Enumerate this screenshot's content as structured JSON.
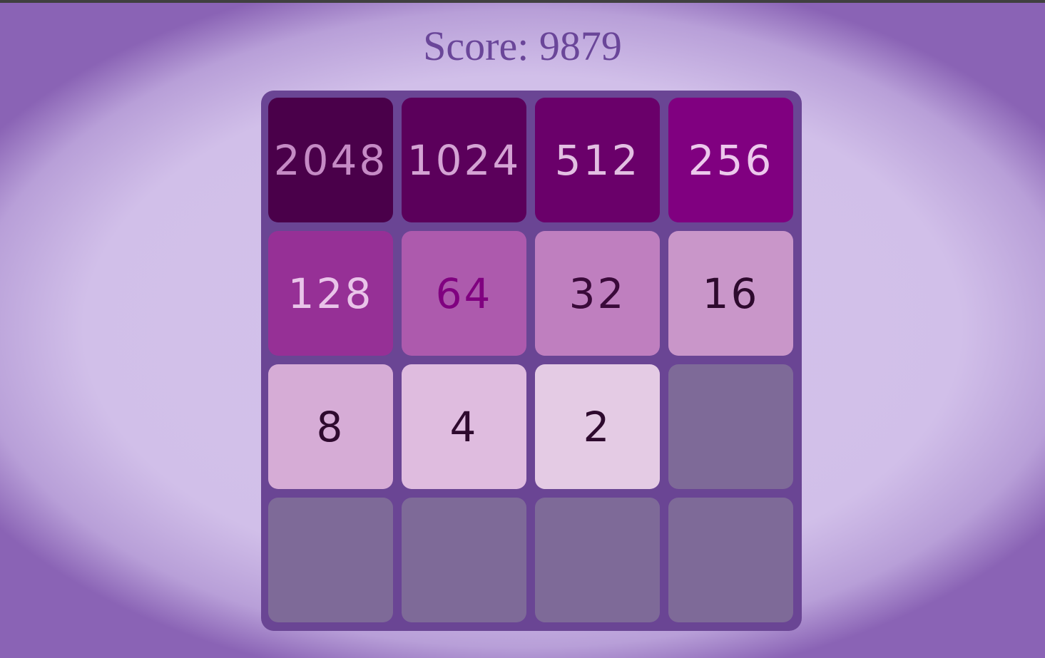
{
  "score": {
    "label": "Score: 9879"
  },
  "board": {
    "rows": [
      [
        {
          "value": "2048",
          "bg": "#4a004a",
          "fg": "#c58ac5"
        },
        {
          "value": "1024",
          "bg": "#5b005b",
          "fg": "#d4a3d4"
        },
        {
          "value": "512",
          "bg": "#6a006a",
          "fg": "#e2bfe2"
        },
        {
          "value": "256",
          "bg": "#800080",
          "fg": "#ecc8ec"
        }
      ],
      [
        {
          "value": "128",
          "bg": "#963096",
          "fg": "#e9c4e9"
        },
        {
          "value": "64",
          "bg": "#ad5aad",
          "fg": "#800080"
        },
        {
          "value": "32",
          "bg": "#bf7fbf",
          "fg": "#3a0a3a"
        },
        {
          "value": "16",
          "bg": "#c996c9",
          "fg": "#2e0a2e"
        }
      ],
      [
        {
          "value": "8",
          "bg": "#d6acd6",
          "fg": "#2e0a2e"
        },
        {
          "value": "4",
          "bg": "#dfbcdf",
          "fg": "#2e0a2e"
        },
        {
          "value": "2",
          "bg": "#e4cbe4",
          "fg": "#2e0a2e"
        },
        {
          "value": "",
          "bg": "#7e6a98",
          "fg": "#2e0a2e"
        }
      ],
      [
        {
          "value": "",
          "bg": "#7e6a98",
          "fg": "#2e0a2e"
        },
        {
          "value": "",
          "bg": "#7e6a98",
          "fg": "#2e0a2e"
        },
        {
          "value": "",
          "bg": "#7e6a98",
          "fg": "#2e0a2e"
        },
        {
          "value": "",
          "bg": "#7e6a98",
          "fg": "#2e0a2e"
        }
      ]
    ]
  }
}
